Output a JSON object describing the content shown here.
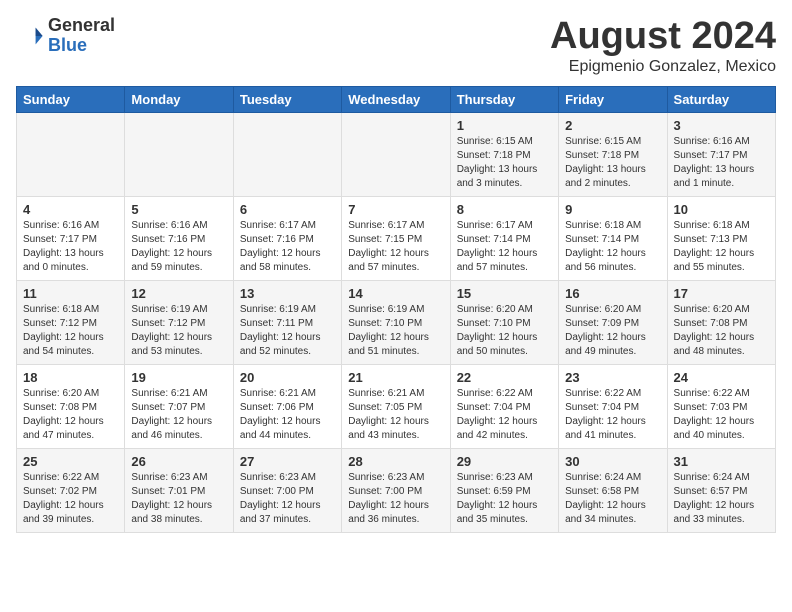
{
  "header": {
    "logo_general": "General",
    "logo_blue": "Blue",
    "month_title": "August 2024",
    "location": "Epigmenio Gonzalez, Mexico"
  },
  "days_of_week": [
    "Sunday",
    "Monday",
    "Tuesday",
    "Wednesday",
    "Thursday",
    "Friday",
    "Saturday"
  ],
  "weeks": [
    [
      {
        "day": "",
        "info": ""
      },
      {
        "day": "",
        "info": ""
      },
      {
        "day": "",
        "info": ""
      },
      {
        "day": "",
        "info": ""
      },
      {
        "day": "1",
        "info": "Sunrise: 6:15 AM\nSunset: 7:18 PM\nDaylight: 13 hours\nand 3 minutes."
      },
      {
        "day": "2",
        "info": "Sunrise: 6:15 AM\nSunset: 7:18 PM\nDaylight: 13 hours\nand 2 minutes."
      },
      {
        "day": "3",
        "info": "Sunrise: 6:16 AM\nSunset: 7:17 PM\nDaylight: 13 hours\nand 1 minute."
      }
    ],
    [
      {
        "day": "4",
        "info": "Sunrise: 6:16 AM\nSunset: 7:17 PM\nDaylight: 13 hours\nand 0 minutes."
      },
      {
        "day": "5",
        "info": "Sunrise: 6:16 AM\nSunset: 7:16 PM\nDaylight: 12 hours\nand 59 minutes."
      },
      {
        "day": "6",
        "info": "Sunrise: 6:17 AM\nSunset: 7:16 PM\nDaylight: 12 hours\nand 58 minutes."
      },
      {
        "day": "7",
        "info": "Sunrise: 6:17 AM\nSunset: 7:15 PM\nDaylight: 12 hours\nand 57 minutes."
      },
      {
        "day": "8",
        "info": "Sunrise: 6:17 AM\nSunset: 7:14 PM\nDaylight: 12 hours\nand 57 minutes."
      },
      {
        "day": "9",
        "info": "Sunrise: 6:18 AM\nSunset: 7:14 PM\nDaylight: 12 hours\nand 56 minutes."
      },
      {
        "day": "10",
        "info": "Sunrise: 6:18 AM\nSunset: 7:13 PM\nDaylight: 12 hours\nand 55 minutes."
      }
    ],
    [
      {
        "day": "11",
        "info": "Sunrise: 6:18 AM\nSunset: 7:12 PM\nDaylight: 12 hours\nand 54 minutes."
      },
      {
        "day": "12",
        "info": "Sunrise: 6:19 AM\nSunset: 7:12 PM\nDaylight: 12 hours\nand 53 minutes."
      },
      {
        "day": "13",
        "info": "Sunrise: 6:19 AM\nSunset: 7:11 PM\nDaylight: 12 hours\nand 52 minutes."
      },
      {
        "day": "14",
        "info": "Sunrise: 6:19 AM\nSunset: 7:10 PM\nDaylight: 12 hours\nand 51 minutes."
      },
      {
        "day": "15",
        "info": "Sunrise: 6:20 AM\nSunset: 7:10 PM\nDaylight: 12 hours\nand 50 minutes."
      },
      {
        "day": "16",
        "info": "Sunrise: 6:20 AM\nSunset: 7:09 PM\nDaylight: 12 hours\nand 49 minutes."
      },
      {
        "day": "17",
        "info": "Sunrise: 6:20 AM\nSunset: 7:08 PM\nDaylight: 12 hours\nand 48 minutes."
      }
    ],
    [
      {
        "day": "18",
        "info": "Sunrise: 6:20 AM\nSunset: 7:08 PM\nDaylight: 12 hours\nand 47 minutes."
      },
      {
        "day": "19",
        "info": "Sunrise: 6:21 AM\nSunset: 7:07 PM\nDaylight: 12 hours\nand 46 minutes."
      },
      {
        "day": "20",
        "info": "Sunrise: 6:21 AM\nSunset: 7:06 PM\nDaylight: 12 hours\nand 44 minutes."
      },
      {
        "day": "21",
        "info": "Sunrise: 6:21 AM\nSunset: 7:05 PM\nDaylight: 12 hours\nand 43 minutes."
      },
      {
        "day": "22",
        "info": "Sunrise: 6:22 AM\nSunset: 7:04 PM\nDaylight: 12 hours\nand 42 minutes."
      },
      {
        "day": "23",
        "info": "Sunrise: 6:22 AM\nSunset: 7:04 PM\nDaylight: 12 hours\nand 41 minutes."
      },
      {
        "day": "24",
        "info": "Sunrise: 6:22 AM\nSunset: 7:03 PM\nDaylight: 12 hours\nand 40 minutes."
      }
    ],
    [
      {
        "day": "25",
        "info": "Sunrise: 6:22 AM\nSunset: 7:02 PM\nDaylight: 12 hours\nand 39 minutes."
      },
      {
        "day": "26",
        "info": "Sunrise: 6:23 AM\nSunset: 7:01 PM\nDaylight: 12 hours\nand 38 minutes."
      },
      {
        "day": "27",
        "info": "Sunrise: 6:23 AM\nSunset: 7:00 PM\nDaylight: 12 hours\nand 37 minutes."
      },
      {
        "day": "28",
        "info": "Sunrise: 6:23 AM\nSunset: 7:00 PM\nDaylight: 12 hours\nand 36 minutes."
      },
      {
        "day": "29",
        "info": "Sunrise: 6:23 AM\nSunset: 6:59 PM\nDaylight: 12 hours\nand 35 minutes."
      },
      {
        "day": "30",
        "info": "Sunrise: 6:24 AM\nSunset: 6:58 PM\nDaylight: 12 hours\nand 34 minutes."
      },
      {
        "day": "31",
        "info": "Sunrise: 6:24 AM\nSunset: 6:57 PM\nDaylight: 12 hours\nand 33 minutes."
      }
    ]
  ]
}
